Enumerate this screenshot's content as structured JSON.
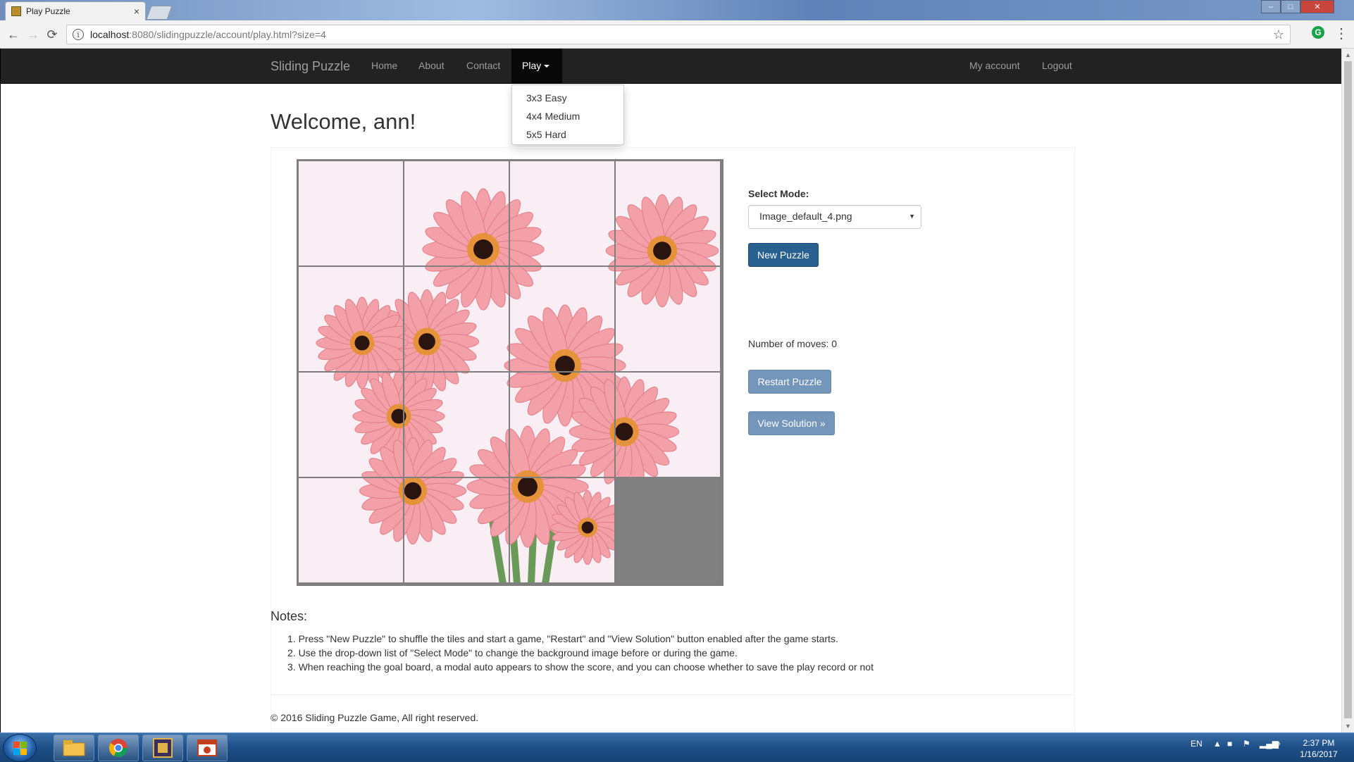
{
  "browser": {
    "tab_title": "Play Puzzle",
    "tab_close": "×",
    "url_host": "localhost",
    "url_path": ":8080/slidingpuzzle/account/play.html?size=4",
    "back_glyph": "←",
    "forward_glyph": "→",
    "reload_glyph": "⟳",
    "info_glyph": "i",
    "star_glyph": "☆",
    "extension_glyph": "G",
    "menu_glyph": "⋮",
    "window_minimize": "–",
    "window_maximize": "□",
    "window_close": "✕"
  },
  "navbar": {
    "brand": "Sliding Puzzle",
    "links": [
      "Home",
      "About",
      "Contact"
    ],
    "play_label": "Play",
    "right_links": [
      "My account",
      "Logout"
    ],
    "dropdown_items": [
      "3x3 Easy",
      "4x4 Medium",
      "5x5 Hard"
    ]
  },
  "main": {
    "welcome": "Welcome, ann!",
    "puzzle_size": 4,
    "empty_tile_index": 15,
    "select_label": "Select Mode:",
    "select_value": "Image_default_4.png",
    "new_puzzle_button": "New Puzzle",
    "moves_text": "Number of moves: 0",
    "restart_button": "Restart Puzzle",
    "solution_button": "View Solution »"
  },
  "notes": {
    "title": "Notes:",
    "items": [
      "1. Press \"New Puzzle\" to shuffle the tiles and start a game, \"Restart\" and \"View Solution\" button enabled after the game starts.",
      "2. Use the drop-down list of \"Select Mode\" to change the background image before or during the game.",
      "3. When reaching the goal board, a modal auto appears to show the score, and you can choose whether to save the play record or not"
    ]
  },
  "footer": {
    "copyright": "© 2016 Sliding Puzzle Game, All right reserved."
  },
  "taskbar": {
    "language": "EN",
    "time": "2:37 PM",
    "date": "1/16/2017"
  },
  "colors": {
    "navbar_bg": "#222222",
    "primary_button": "#286090",
    "muted_button": "#7396ba",
    "flower_petal": "#f4a0a8",
    "flower_center": "#2a1410"
  },
  "icons": {
    "start": "windows-start-icon",
    "taskbar_apps": [
      "file-explorer-icon",
      "chrome-icon",
      "ide-icon",
      "presentation-icon"
    ]
  }
}
